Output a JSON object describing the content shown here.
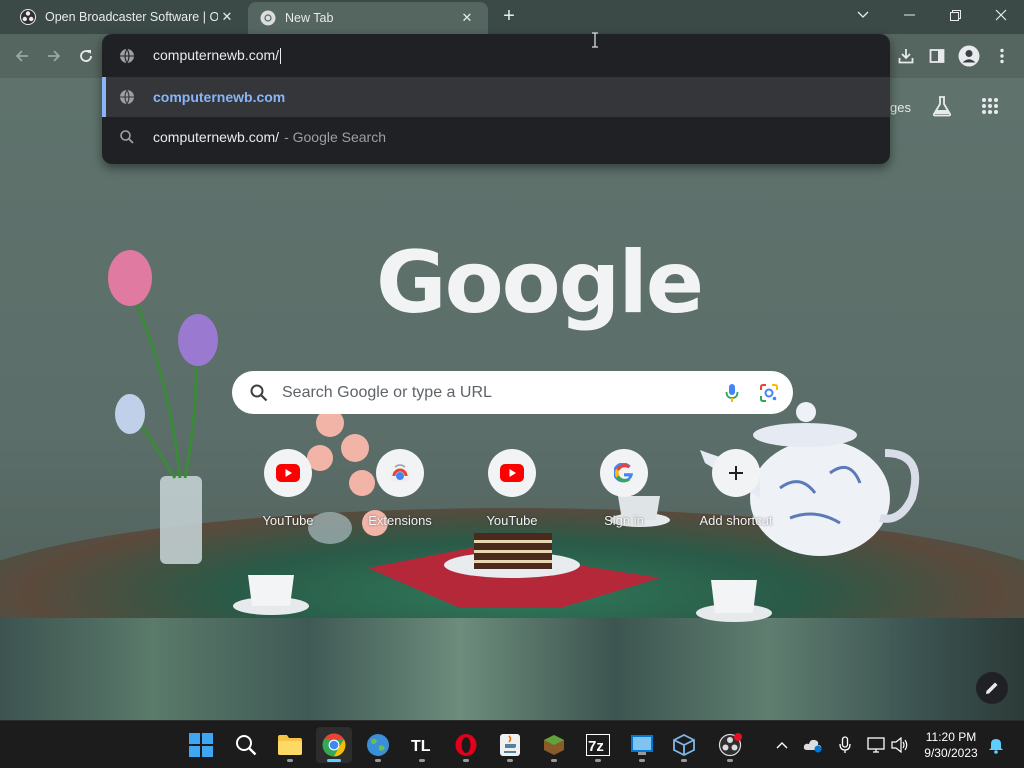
{
  "tabs": [
    {
      "title": "Open Broadcaster Software | OBS",
      "active": false
    },
    {
      "title": "New Tab",
      "active": true
    }
  ],
  "new_tab_symbol": "+",
  "window_controls": [
    "tab-search",
    "minimize",
    "restore",
    "close"
  ],
  "omnibox": {
    "typed": "computernewb.com/",
    "suggestions": [
      {
        "icon": "globe-icon",
        "text": "computernewb.com",
        "selected": true
      },
      {
        "icon": "search-icon",
        "text": "computernewb.com/",
        "suffix": "- Google Search",
        "selected": false
      }
    ]
  },
  "ntp": {
    "header_link_partial": "ges",
    "logo": "Google",
    "search_placeholder": "Search Google or type a URL",
    "shortcuts": [
      {
        "label": "YouTube",
        "icon": "youtube-icon"
      },
      {
        "label": "Extensions",
        "icon": "chrome-web-store-icon"
      },
      {
        "label": "YouTube",
        "icon": "youtube-icon"
      },
      {
        "label": "Sign in",
        "icon": "google-g-icon"
      },
      {
        "label": "Add shortcut",
        "icon": "plus-icon"
      }
    ]
  },
  "taskbar": {
    "apps": [
      "start",
      "search",
      "file-explorer",
      "chrome",
      "earth",
      "tl",
      "opera",
      "java",
      "minecraft",
      "7zip",
      "remote-desktop",
      "virtualbox",
      "obs"
    ],
    "clock_time": "11:20 PM",
    "clock_date": "9/30/2023"
  },
  "colors": {
    "accent_blue": "#8ab4f8",
    "omnibox_bg": "#202124",
    "toolbar_bg": "#55655f",
    "youtube_red": "#ff0000"
  }
}
